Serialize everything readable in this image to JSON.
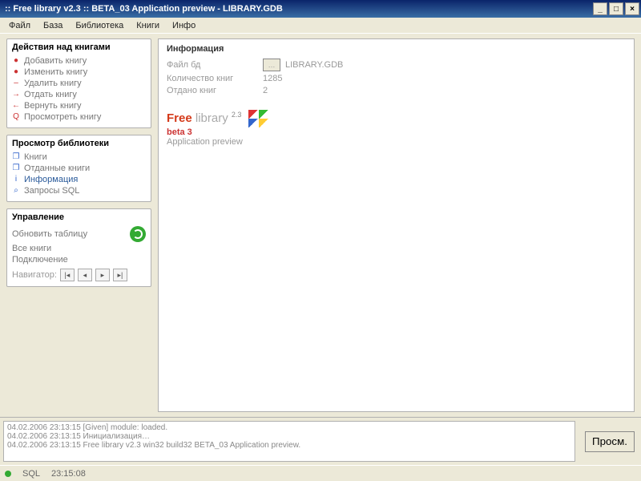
{
  "window": {
    "title": ":: Free library  v2.3 :: BETA_03 Application preview - LIBRARY.GDB"
  },
  "menu": [
    "Файл",
    "База",
    "Библиотека",
    "Книги",
    "Инфо"
  ],
  "sidebar": {
    "panel1": {
      "title": "Действия над книгами",
      "items": [
        {
          "icon": "●",
          "color": "#c33",
          "label": "Добавить книгу"
        },
        {
          "icon": "●",
          "color": "#c33",
          "label": "Изменить книгу"
        },
        {
          "icon": "–",
          "color": "#c33",
          "label": "Удалить книгу"
        },
        {
          "icon": "→",
          "color": "#c33",
          "label": "Отдать книгу"
        },
        {
          "icon": "←",
          "color": "#c33",
          "label": "Вернуть книгу"
        },
        {
          "icon": "Q",
          "color": "#c33",
          "label": "Просмотреть книгу"
        }
      ]
    },
    "panel2": {
      "title": "Просмотр библиотеки",
      "items": [
        {
          "icon": "❐",
          "color": "#36c",
          "label": "Книги",
          "selected": false
        },
        {
          "icon": "❐",
          "color": "#36c",
          "label": "Отданные книги",
          "selected": false
        },
        {
          "icon": "i",
          "color": "#36c",
          "label": "Информация",
          "selected": true
        },
        {
          "icon": "⌕",
          "color": "#36c",
          "label": "Запросы SQL",
          "selected": false
        }
      ]
    },
    "panel3": {
      "title": "Управление",
      "refresh_label": "Обновить таблицу",
      "all_label": "Все книги",
      "connect_label": "Подключение",
      "navigator_label": "Навигатор:"
    }
  },
  "content": {
    "heading": "Информация",
    "file_label": "Файл бд",
    "file_value": "LIBRARY.GDB",
    "count_label": "Количество книг",
    "count_value": "1285",
    "given_label": "Отдано книг",
    "given_value": "2",
    "logo": {
      "free": "Free",
      "lib": "library",
      "ver": "2.3",
      "beta": "beta 3",
      "sub": "Application preview"
    }
  },
  "log": {
    "l1": "04.02.2006 23:13:15  [Given] module: loaded.",
    "l2": "04.02.2006 23:13:15  Инициализация…",
    "l3": "04.02.2006 23:13:15  Free library v2.3 win32 build32 BETA_03 Application preview."
  },
  "view_btn": "Просм.",
  "status": {
    "sql": "SQL",
    "time": "23:15:08"
  }
}
